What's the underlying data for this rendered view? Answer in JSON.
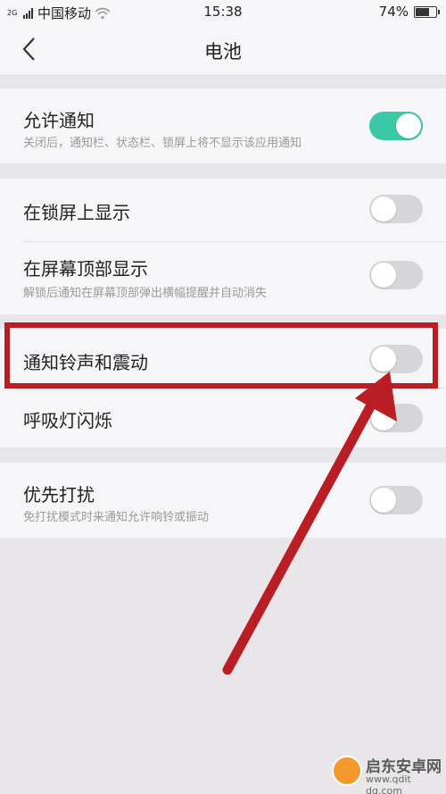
{
  "status_bar": {
    "network": "2G",
    "carrier": "中国移动",
    "time": "15:38",
    "battery_percent": "74%",
    "battery_level": 0.74
  },
  "header": {
    "title": "电池",
    "back_icon": "chevron-left-icon"
  },
  "settings": {
    "allow_notifications": {
      "title": "允许通知",
      "subtitle": "关闭后，通知栏、状态栏、锁屏上将不显示该应用通知",
      "enabled": true
    },
    "show_on_lockscreen": {
      "title": "在锁屏上显示",
      "enabled": false
    },
    "show_on_top": {
      "title": "在屏幕顶部显示",
      "subtitle": "解锁后通知在屏幕顶部弹出横幅提醒并自动消失",
      "enabled": false
    },
    "sound_vibration": {
      "title": "通知铃声和震动",
      "enabled": false
    },
    "breathing_light": {
      "title": "呼吸灯闪烁",
      "enabled": false
    },
    "priority_interrupt": {
      "title": "优先打扰",
      "subtitle": "免打扰模式时来通知允许响铃或振动",
      "enabled": false
    }
  },
  "colors": {
    "toggle_on": "#3bc8a6",
    "toggle_off": "#d6d6d8",
    "annotation_red": "#b81e23",
    "background": "#e8e6e9",
    "card": "#f6f5f7"
  },
  "watermark": {
    "name": "启东安卓网",
    "url": "www.qdit dq.com"
  }
}
